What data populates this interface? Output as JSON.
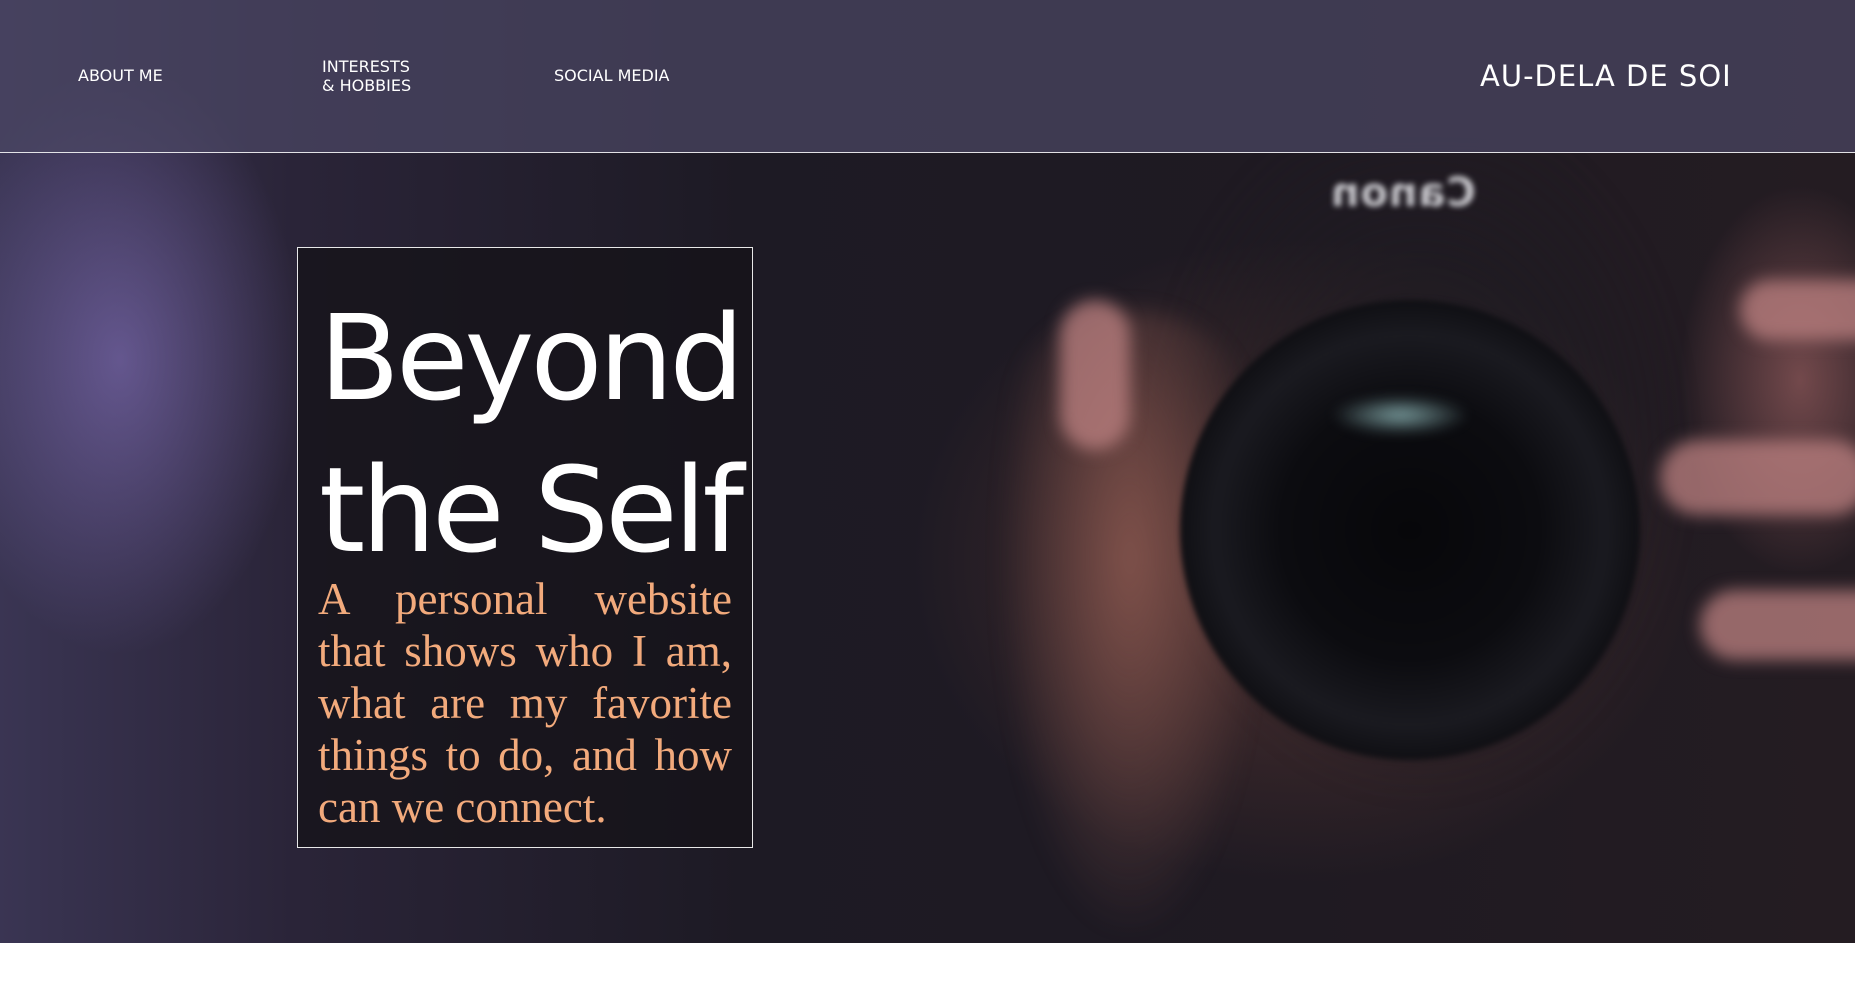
{
  "nav": {
    "about": "ABOUT ME",
    "interests_line1": "INTERESTS",
    "interests_line2": "& HOBBIES",
    "social": "SOCIAL MEDIA"
  },
  "brand": "AU-DELA DE SOI",
  "hero": {
    "title_line1": "Beyond",
    "title_line2": "the Self",
    "description": "A personal website that shows who I am, what are my favorite things to do, and how can we connect.",
    "photo_brand_text": "Canon"
  },
  "colors": {
    "nav_overlay": "#4b4664",
    "card_bg": "#16131a",
    "accent_text": "#f2aa7c",
    "text_primary": "#ffffff"
  }
}
